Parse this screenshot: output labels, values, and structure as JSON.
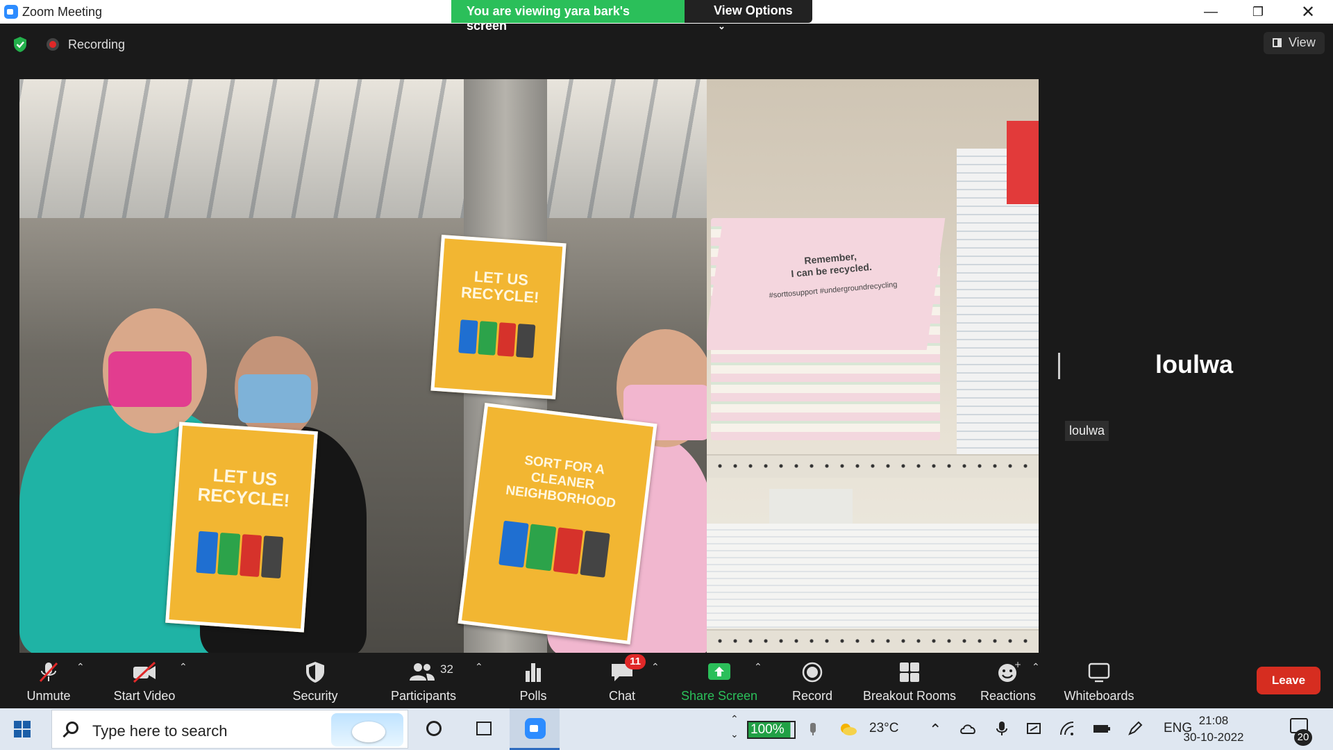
{
  "window": {
    "title": "Zoom Meeting"
  },
  "share_banner": {
    "viewing_text": "You are viewing yara bark's screen",
    "options_label": "View Options"
  },
  "header": {
    "recording_label": "Recording",
    "view_label": "View"
  },
  "shared_content": {
    "poster_left_text": "LET US RECYCLE!",
    "poster_top_text": "LET US RECYCLE!",
    "poster_right_text": "SORT FOR A CLEANER NEIGHBORHOOD",
    "notebook_text_line1": "Remember,",
    "notebook_text_line2": "I can be recycled.",
    "notebook_hashtags": "#sorttosupport #undergroundrecycling"
  },
  "participant": {
    "name_big": "loulwa",
    "name_tag": "loulwa"
  },
  "toolbar": {
    "unmute": "Unmute",
    "start_video": "Start Video",
    "security": "Security",
    "participants": "Participants",
    "participants_count": "32",
    "polls": "Polls",
    "chat": "Chat",
    "chat_badge": "11",
    "share_screen": "Share Screen",
    "record": "Record",
    "breakout_rooms": "Breakout Rooms",
    "reactions": "Reactions",
    "whiteboards": "Whiteboards",
    "leave": "Leave"
  },
  "taskbar": {
    "search_placeholder": "Type here to search",
    "battery_percent": "100%",
    "temperature": "23°C",
    "language": "ENG",
    "time": "21:08",
    "date": "30-10-2022",
    "notification_count": "20"
  },
  "colors": {
    "banner_green": "#2bbf5a",
    "share_green": "#2bbf5a",
    "leave_red": "#d62d20",
    "chat_badge_red": "#e02828",
    "zoom_blue": "#2d8cff"
  }
}
